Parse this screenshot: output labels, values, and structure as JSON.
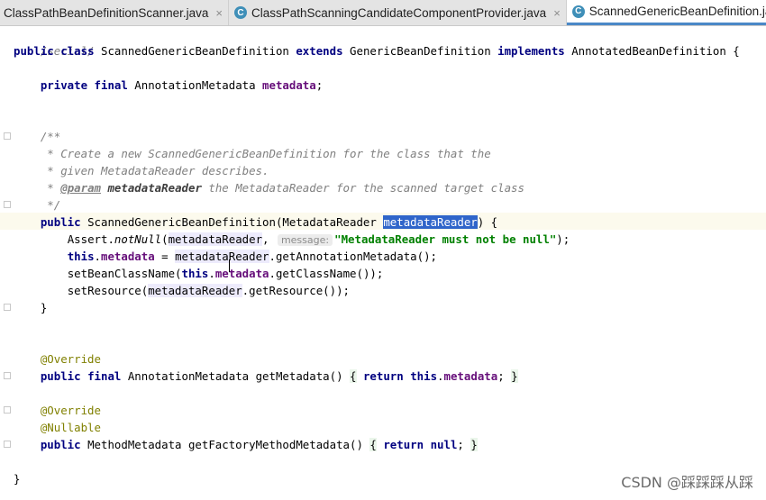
{
  "tabs": [
    {
      "label": "ClassPathBeanDefinitionScanner.java",
      "icon": "none",
      "close": "×"
    },
    {
      "label": "ClassPathScanningCandidateComponentProvider.java",
      "icon": "C",
      "close": "×"
    },
    {
      "label": "ScannedGenericBeanDefinition.ja",
      "icon": "C",
      "close": ""
    }
  ],
  "code": {
    "l0": "/serial/",
    "l1_public": "public",
    "l1_class": "class",
    "l1_name": " ScannedGenericBeanDefinition ",
    "l1_extends": "extends",
    "l1_super": " GenericBeanDefinition ",
    "l1_implements": "implements",
    "l1_iface": " AnnotatedBeanDefinition {",
    "l3_private": "private",
    "l3_final": "final",
    "l3_type": " AnnotationMetadata ",
    "l3_field": "metadata",
    "l3_end": ";",
    "c1": "/**",
    "c2": " * Create a new ScannedGenericBeanDefinition for the class that the",
    "c3": " * given MetadataReader describes.",
    "c4_star": " * ",
    "c4_tag": "@param",
    "c4_name": "metadataReader",
    "c4_rest": " the MetadataReader for the scanned target class",
    "c5": " */",
    "ctor_public": "public",
    "ctor_sig": " ScannedGenericBeanDefinition(MetadataReader ",
    "ctor_param": "metadataReader",
    "ctor_end": ") {",
    "b1_assert": "Assert.",
    "b1_notnull": "notNull",
    "b1_open": "(",
    "b1_arg": "metadataReader",
    "b1_comma": ", ",
    "b1_hint": "message:",
    "b1_str": "\"MetadataReader must not be null\"",
    "b1_end": ");",
    "b2_this": "this",
    "b2_dot": ".",
    "b2_field": "metadata",
    "b2_eq": " = ",
    "b2_ref": "metadataReader",
    "b2_call": ".getAnnotationMetadata();",
    "b3_call": "setBeanClassName(",
    "b3_this": "this",
    "b3_dot": ".",
    "b3_field": "metadata",
    "b3_rest": ".getClassName());",
    "b4_call": "setResource(",
    "b4_ref": "metadataReader",
    "b4_rest": ".getResource());",
    "close1": "}",
    "ann1": "@Override",
    "m1_public": "public",
    "m1_final": "final",
    "m1_sig": " AnnotationMetadata getMetadata() ",
    "m1_ob": "{",
    "m1_return": "return",
    "m1_this": "this",
    "m1_dot": ".",
    "m1_field": "metadata",
    "m1_semi": "; ",
    "m1_cb": "}",
    "ann2": "@Override",
    "ann3": "@Nullable",
    "m2_public": "public",
    "m2_sig": " MethodMetadata getFactoryMethodMetadata() ",
    "m2_ob": "{",
    "m2_return": "return",
    "m2_null": "null",
    "m2_semi": "; ",
    "m2_cb": "}",
    "close2": "}"
  },
  "watermark": "CSDN @踩踩踩从踩",
  "colors": {
    "keyword": "#000080",
    "field": "#660e7a",
    "string": "#008000",
    "annotation": "#808000",
    "comment": "#808080",
    "selection": "#2f65ca"
  }
}
